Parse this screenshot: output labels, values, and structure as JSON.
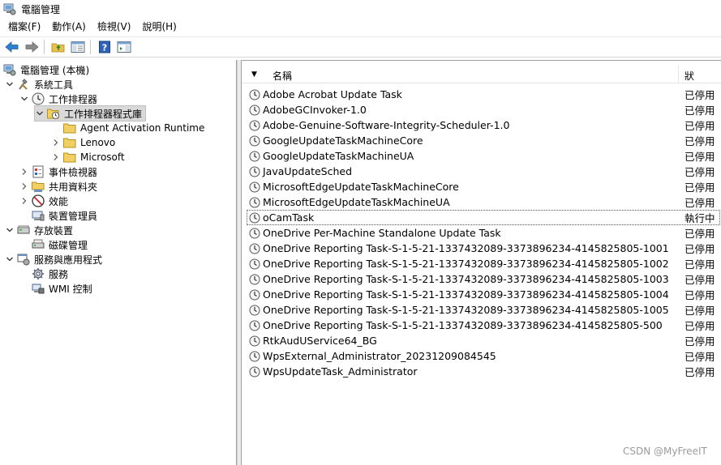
{
  "window": {
    "title": "電腦管理"
  },
  "menu": [
    "檔案(F)",
    "動作(A)",
    "檢視(V)",
    "說明(H)"
  ],
  "tree": {
    "items": [
      {
        "label": "電腦管理 (本機)",
        "icon": "computer-management-icon",
        "chevron": "none"
      },
      {
        "label": "系統工具",
        "icon": "tools-icon",
        "chevron": "expanded"
      },
      {
        "label": "工作排程器",
        "icon": "task-scheduler-icon",
        "chevron": "expanded"
      },
      {
        "label": "工作排程器程式庫",
        "icon": "folder-clock-icon",
        "chevron": "expanded",
        "selected": true
      },
      {
        "label": "Agent Activation Runtime",
        "icon": "folder-icon",
        "chevron": "none"
      },
      {
        "label": "Lenovo",
        "icon": "folder-icon",
        "chevron": "collapsed"
      },
      {
        "label": "Microsoft",
        "icon": "folder-icon",
        "chevron": "collapsed"
      },
      {
        "label": "事件檢視器",
        "icon": "event-viewer-icon",
        "chevron": "collapsed"
      },
      {
        "label": "共用資料夾",
        "icon": "shared-folders-icon",
        "chevron": "collapsed"
      },
      {
        "label": "效能",
        "icon": "performance-icon",
        "chevron": "collapsed"
      },
      {
        "label": "裝置管理員",
        "icon": "device-manager-icon",
        "chevron": "none"
      },
      {
        "label": "存放裝置",
        "icon": "storage-icon",
        "chevron": "expanded"
      },
      {
        "label": "磁碟管理",
        "icon": "disk-management-icon",
        "chevron": "none"
      },
      {
        "label": "服務與應用程式",
        "icon": "services-apps-icon",
        "chevron": "expanded"
      },
      {
        "label": "服務",
        "icon": "services-gear-icon",
        "chevron": "none"
      },
      {
        "label": "WMI 控制",
        "icon": "wmi-control-icon",
        "chevron": "none"
      }
    ]
  },
  "list": {
    "headers": {
      "name": "名稱",
      "status": "狀"
    },
    "rows": [
      {
        "name": "Adobe Acrobat Update Task",
        "status": "已停用"
      },
      {
        "name": "AdobeGCInvoker-1.0",
        "status": "已停用"
      },
      {
        "name": "Adobe-Genuine-Software-Integrity-Scheduler-1.0",
        "status": "已停用"
      },
      {
        "name": "GoogleUpdateTaskMachineCore",
        "status": "已停用"
      },
      {
        "name": "GoogleUpdateTaskMachineUA",
        "status": "已停用"
      },
      {
        "name": "JavaUpdateSched",
        "status": "已停用"
      },
      {
        "name": "MicrosoftEdgeUpdateTaskMachineCore",
        "status": "已停用"
      },
      {
        "name": "MicrosoftEdgeUpdateTaskMachineUA",
        "status": "已停用"
      },
      {
        "name": "oCamTask",
        "status": "執行中",
        "focused": true
      },
      {
        "name": "OneDrive Per-Machine Standalone Update Task",
        "status": "已停用"
      },
      {
        "name": "OneDrive Reporting Task-S-1-5-21-1337432089-3373896234-4145825805-1001",
        "status": "已停用"
      },
      {
        "name": "OneDrive Reporting Task-S-1-5-21-1337432089-3373896234-4145825805-1002",
        "status": "已停用"
      },
      {
        "name": "OneDrive Reporting Task-S-1-5-21-1337432089-3373896234-4145825805-1003",
        "status": "已停用"
      },
      {
        "name": "OneDrive Reporting Task-S-1-5-21-1337432089-3373896234-4145825805-1004",
        "status": "已停用"
      },
      {
        "name": "OneDrive Reporting Task-S-1-5-21-1337432089-3373896234-4145825805-1005",
        "status": "已停用"
      },
      {
        "name": "OneDrive Reporting Task-S-1-5-21-1337432089-3373896234-4145825805-500",
        "status": "已停用"
      },
      {
        "name": "RtkAudUService64_BG",
        "status": "已停用"
      },
      {
        "name": "WpsExternal_Administrator_20231209084545",
        "status": "已停用"
      },
      {
        "name": "WpsUpdateTask_Administrator",
        "status": "已停用"
      }
    ]
  },
  "watermark": "CSDN @MyFreeIT"
}
